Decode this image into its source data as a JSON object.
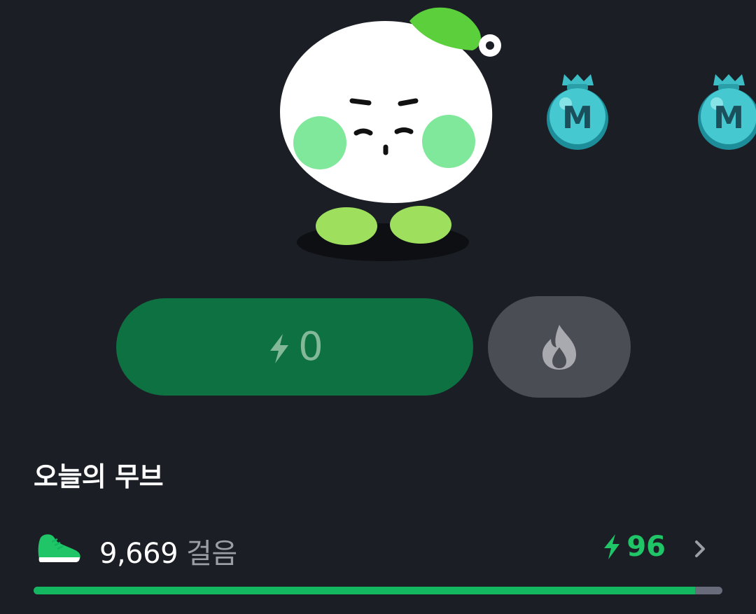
{
  "energy": {
    "value": "0"
  },
  "today_move": {
    "title": "오늘의 무브",
    "steps": "9,669",
    "steps_unit": "걸음",
    "reward": "96",
    "progress_fraction": 0.96
  },
  "coins": [
    {
      "label": "M"
    },
    {
      "label": "M"
    }
  ],
  "colors": {
    "background": "#1b1f25",
    "energy_button": "#0e7142",
    "fire_button": "#4b4d54",
    "accent_green": "#1fc567",
    "progress_fill": "#12b760",
    "progress_track": "#686c7a"
  },
  "icons": [
    "bolt-icon",
    "flame-icon",
    "shoe-icon",
    "chevron-right-icon",
    "coin-bag-icon"
  ]
}
